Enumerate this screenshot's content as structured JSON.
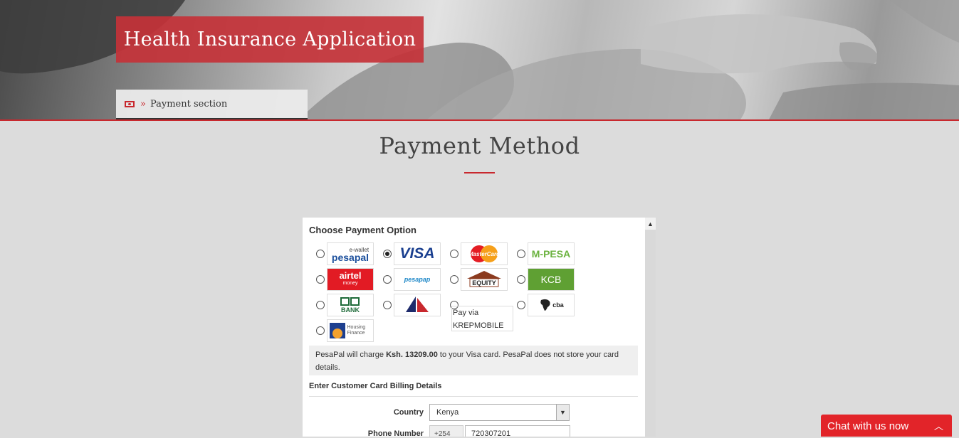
{
  "hero": {
    "title": "Health Insurance Application",
    "breadcrumb_separator": "»",
    "breadcrumb_label": "Payment section",
    "breadcrumb_icon": "money-icon"
  },
  "page_heading": "Payment Method",
  "payment": {
    "title": "Choose Payment Option",
    "options": [
      {
        "name": "pesapal",
        "logo_text": "pesapal",
        "logo_sub": "e-wallet",
        "selected": false
      },
      {
        "name": "visa",
        "logo_text": "VISA",
        "selected": true
      },
      {
        "name": "mastercard",
        "logo_text": "MasterCard",
        "selected": false
      },
      {
        "name": "mpesa",
        "logo_text": "M-PESA",
        "selected": false
      },
      {
        "name": "airtel-money",
        "logo_text": "airtel",
        "logo_sub": "money",
        "selected": false
      },
      {
        "name": "pesapap",
        "logo_text": "pesapap",
        "selected": false
      },
      {
        "name": "equity",
        "logo_text": "EQUITY",
        "selected": false
      },
      {
        "name": "kcb",
        "logo_text": "KCB",
        "selected": false
      },
      {
        "name": "co-op-bank",
        "logo_text": "BANK",
        "selected": false
      },
      {
        "name": "family-bank",
        "logo_text": "",
        "selected": false
      },
      {
        "name": "krepmobile",
        "logo_text": "Pay via KREPMOBILE",
        "selected": false
      },
      {
        "name": "cba",
        "logo_text": "cba",
        "selected": false
      },
      {
        "name": "housing-finance",
        "logo_text": "Housing Finance",
        "selected": false
      }
    ],
    "info_prefix": "PesaPal will charge ",
    "info_amount": "Ksh. 13209.00",
    "info_suffix": " to your Visa card. PesaPal does not store your card details.",
    "billing_title": "Enter Customer Card Billing Details",
    "country_label": "Country",
    "country_value": "Kenya",
    "phone_label": "Phone Number",
    "phone_prefix": "+254",
    "phone_value": "720307201"
  },
  "chat": {
    "label": "Chat with us now",
    "icon": "chevron-up-icon"
  },
  "colors": {
    "accent": "#c8282e",
    "chat": "#e22429",
    "visa_blue": "#1a3f8f"
  }
}
